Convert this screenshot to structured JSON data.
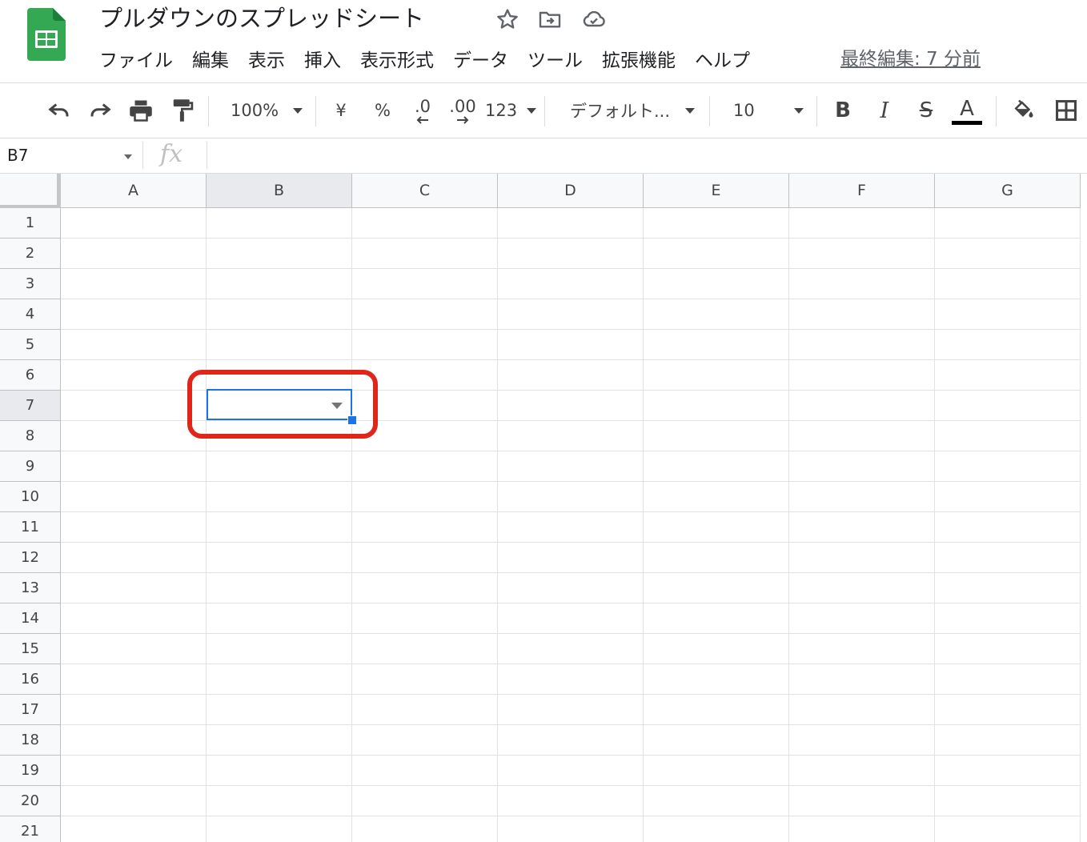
{
  "app": {
    "title": "プルダウンのスプレッドシート",
    "menu": [
      "ファイル",
      "編集",
      "表示",
      "挿入",
      "表示形式",
      "データ",
      "ツール",
      "拡張機能",
      "ヘルプ"
    ],
    "last_edit": "最終編集: 7 分前",
    "brand_color": "#34a853"
  },
  "toolbar": {
    "zoom": "100%",
    "currency": "¥",
    "percent": "%",
    "decimal_decrease": ".0",
    "decimal_increase": ".00",
    "number_format": "123",
    "font": "デフォルト...",
    "font_size": "10",
    "bold": "B",
    "italic": "I",
    "strike": "S",
    "text_color": "A"
  },
  "formula_bar": {
    "name_box": "B7",
    "fx": "fx",
    "formula": ""
  },
  "grid": {
    "columns": [
      "A",
      "B",
      "C",
      "D",
      "E",
      "F",
      "G"
    ],
    "rows": [
      "1",
      "2",
      "3",
      "4",
      "5",
      "6",
      "7",
      "8",
      "9",
      "10",
      "11",
      "12",
      "13",
      "14",
      "15",
      "16",
      "17",
      "18",
      "19",
      "20",
      "21"
    ],
    "selected_column": "B",
    "selected_row": "7",
    "selection_color": "#1a73e8",
    "highlight_color": "#e0251b"
  }
}
